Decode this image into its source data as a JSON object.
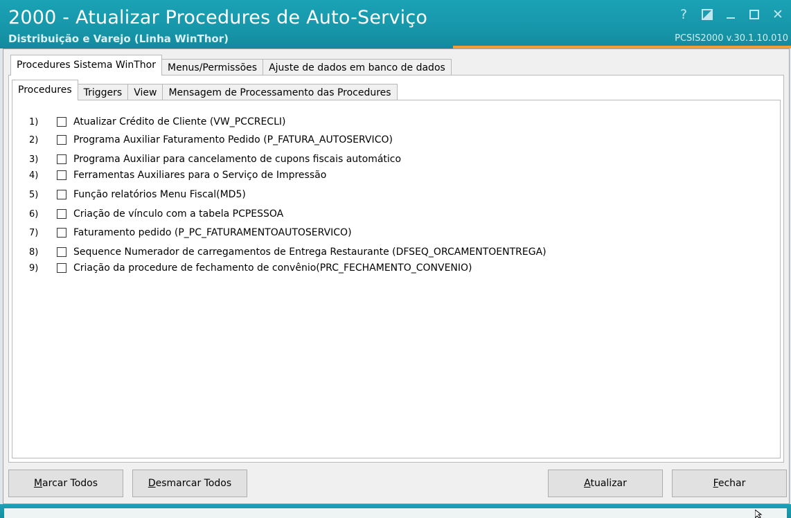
{
  "window": {
    "title": "2000 - Atualizar Procedures de Auto-Serviço",
    "subtitle": "Distribuição e Varejo (Linha WinThor)",
    "version": "PCSIS2000  v.30.1.10.010",
    "controls": {
      "help": "?",
      "close": "✕"
    },
    "colors": {
      "titlebar": "#1796a9",
      "accent": "#f0a032"
    }
  },
  "outer_tabs": [
    {
      "label": "Procedures Sistema WinThor"
    },
    {
      "label": "Menus/Permissões"
    },
    {
      "label": "Ajuste de dados em banco de dados"
    }
  ],
  "inner_tabs": [
    {
      "label": "Procedures"
    },
    {
      "label": "Triggers"
    },
    {
      "label": "View"
    },
    {
      "label": "Mensagem de Processamento das Procedures"
    }
  ],
  "procedures": [
    {
      "num": "1)",
      "label": "Atualizar Crédito de Cliente (VW_PCCRECLI)"
    },
    {
      "num": "2)",
      "label": "Programa Auxiliar Faturamento Pedido  (P_FATURA_AUTOSERVICO)"
    },
    {
      "num": "3)",
      "label": "Programa Auxiliar para cancelamento de cupons fiscais automático"
    },
    {
      "num": "4)",
      "label": "Ferramentas Auxiliares para o Serviço de Impressão"
    },
    {
      "num": "5)",
      "label": "Função relatórios Menu Fiscal(MD5)"
    },
    {
      "num": "6)",
      "label": "Criação de vínculo com a tabela PCPESSOA"
    },
    {
      "num": "7)",
      "label": "Faturamento pedido (P_PC_FATURAMENTOAUTOSERVICO)"
    },
    {
      "num": "8)",
      "label": "Sequence Numerador de carregamentos de Entrega Restaurante (DFSEQ_ORCAMENTOENTREGA)"
    },
    {
      "num": "9)",
      "label": "Criação da procedure de fechamento de convênio(PRC_FECHAMENTO_CONVENIO)"
    }
  ],
  "buttons": {
    "marcar_todos": {
      "hotkey": "M",
      "rest": "arcar Todos"
    },
    "desmarcar_todos": {
      "hotkey": "D",
      "rest": "esmarcar Todos"
    },
    "atualizar": {
      "hotkey": "A",
      "rest": "tualizar"
    },
    "fechar": {
      "hotkey": "F",
      "rest": "echar"
    }
  }
}
